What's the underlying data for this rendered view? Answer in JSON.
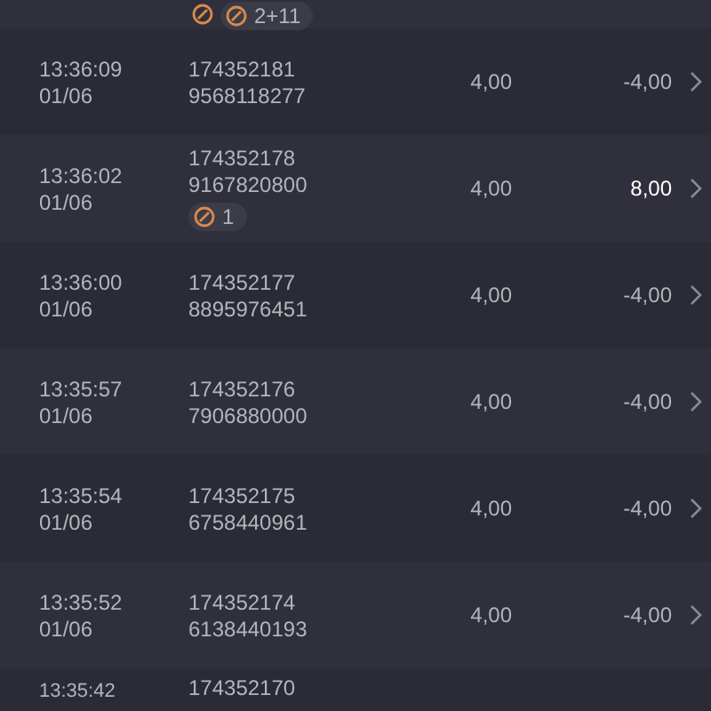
{
  "top_badge": {
    "count": "2+11"
  },
  "rows": [
    {
      "time": "13:36:09",
      "date": "01/06",
      "id": "174352181",
      "code": "9568118277",
      "stake": "4,00",
      "result": "-4,00",
      "positive": false
    },
    {
      "time": "13:36:02",
      "date": "01/06",
      "id": "174352178",
      "code": "9167820800",
      "badge": "1",
      "stake": "4,00",
      "result": "8,00",
      "positive": true
    },
    {
      "time": "13:36:00",
      "date": "01/06",
      "id": "174352177",
      "code": "8895976451",
      "stake": "4,00",
      "result": "-4,00",
      "positive": false
    },
    {
      "time": "13:35:57",
      "date": "01/06",
      "id": "174352176",
      "code": "7906880000",
      "stake": "4,00",
      "result": "-4,00",
      "positive": false
    },
    {
      "time": "13:35:54",
      "date": "01/06",
      "id": "174352175",
      "code": "6758440961",
      "stake": "4,00",
      "result": "-4,00",
      "positive": false
    },
    {
      "time": "13:35:52",
      "date": "01/06",
      "id": "174352174",
      "code": "6138440193",
      "stake": "4,00",
      "result": "-4,00",
      "positive": false
    }
  ],
  "last_row": {
    "time": "13:35:42",
    "id": "174352170"
  }
}
